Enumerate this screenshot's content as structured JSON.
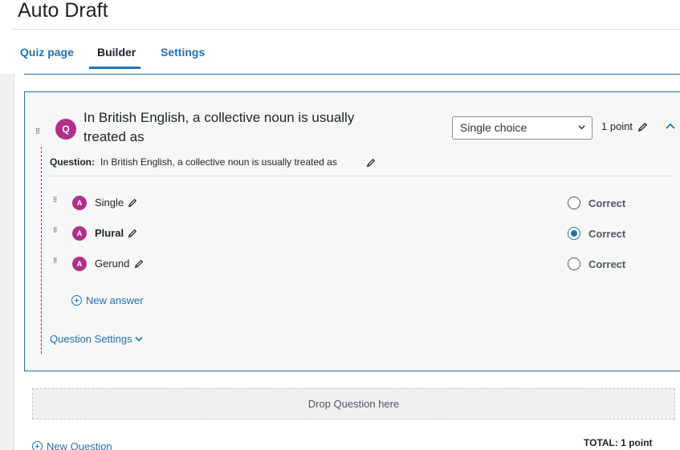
{
  "page": {
    "title": "Auto Draft"
  },
  "tabs": [
    {
      "label": "Quiz page",
      "active": false
    },
    {
      "label": "Builder",
      "active": true
    },
    {
      "label": "Settings",
      "active": false
    }
  ],
  "question": {
    "badge": "Q",
    "title": "In British English, a collective noun is usually treated as",
    "type_select": "Single choice",
    "points": "1 point",
    "label": "Question:",
    "text": "In British English, a collective noun is usually treated as",
    "answers": [
      {
        "badge": "A",
        "text": "Single",
        "correct_label": "Correct",
        "checked": false
      },
      {
        "badge": "A",
        "text": "Plural",
        "correct_label": "Correct",
        "checked": true
      },
      {
        "badge": "A",
        "text": "Gerund",
        "correct_label": "Correct",
        "checked": false
      }
    ],
    "new_answer": "New answer",
    "settings_link": "Question Settings"
  },
  "drop_zone": "Drop Question here",
  "new_question": "New Question",
  "total": "TOTAL: 1 point",
  "colors": {
    "accent": "#2271b1",
    "badge": "#b0308a",
    "card_bg": "#f6f7f7"
  },
  "icons": [
    "drag-handle-icon",
    "pencil-icon",
    "chevron-down-icon",
    "chevron-up-icon",
    "plus-circle-icon"
  ]
}
